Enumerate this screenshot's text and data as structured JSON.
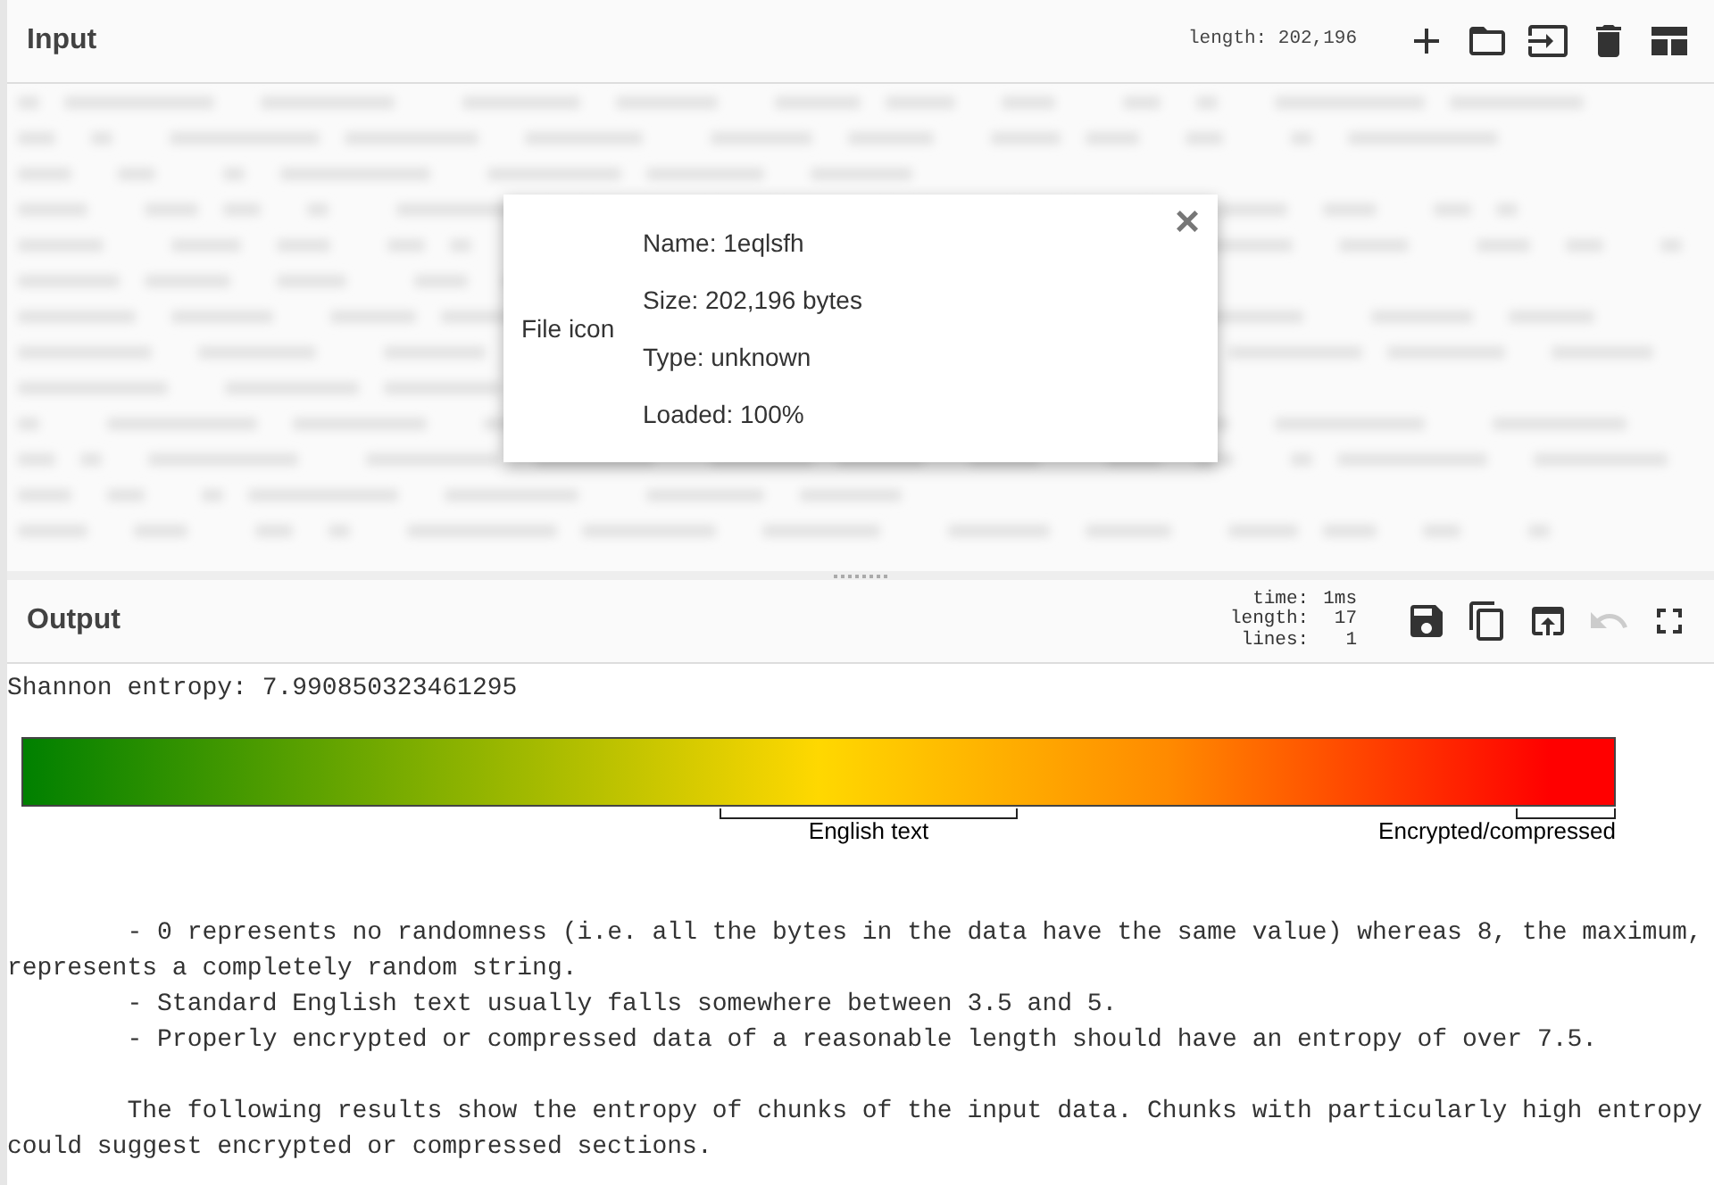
{
  "input": {
    "title": "Input",
    "length": "length: 202,196",
    "buttons": [
      {
        "kind": "add",
        "disabled": false
      },
      {
        "kind": "folder",
        "disabled": false
      },
      {
        "kind": "import",
        "disabled": false
      },
      {
        "kind": "trash",
        "disabled": false
      },
      {
        "kind": "layout",
        "disabled": false
      }
    ],
    "file_dialog": {
      "icon_alt": "File icon",
      "close": "×",
      "details": [
        "Name: 1eqlsfh",
        "Size: 202,196 bytes",
        "Type: unknown",
        "Loaded: 100%"
      ]
    }
  },
  "output": {
    "title": "Output",
    "stats": [
      {
        "label": "time:",
        "value": "1ms"
      },
      {
        "label": "length:",
        "value": "17"
      },
      {
        "label": "lines:",
        "value": "1"
      }
    ],
    "buttons": [
      {
        "kind": "save",
        "disabled": false
      },
      {
        "kind": "copy",
        "disabled": false
      },
      {
        "kind": "replace-input",
        "disabled": false
      },
      {
        "kind": "undo",
        "disabled": true
      },
      {
        "kind": "maximise",
        "disabled": false
      }
    ],
    "result": "Shannon entropy: 7.990850323461295",
    "scale_labels": [
      "English text",
      "Encrypted/compressed"
    ],
    "notes": [
      "\t- 0 represents no randomness (i.e. all the bytes in the data have the same value) whereas 8, the maximum, represents a completely random string.",
      "\t- Standard English text usually falls somewhere between 3.5 and 5.",
      "\t- Properly encrypted or compressed data of a reasonable length should have an entropy of over 7.5."
    ],
    "chunks_intro": "\tThe following results show the entropy of chunks of the input data. Chunks with particularly high entropy could suggest encrypted or compressed sections."
  }
}
